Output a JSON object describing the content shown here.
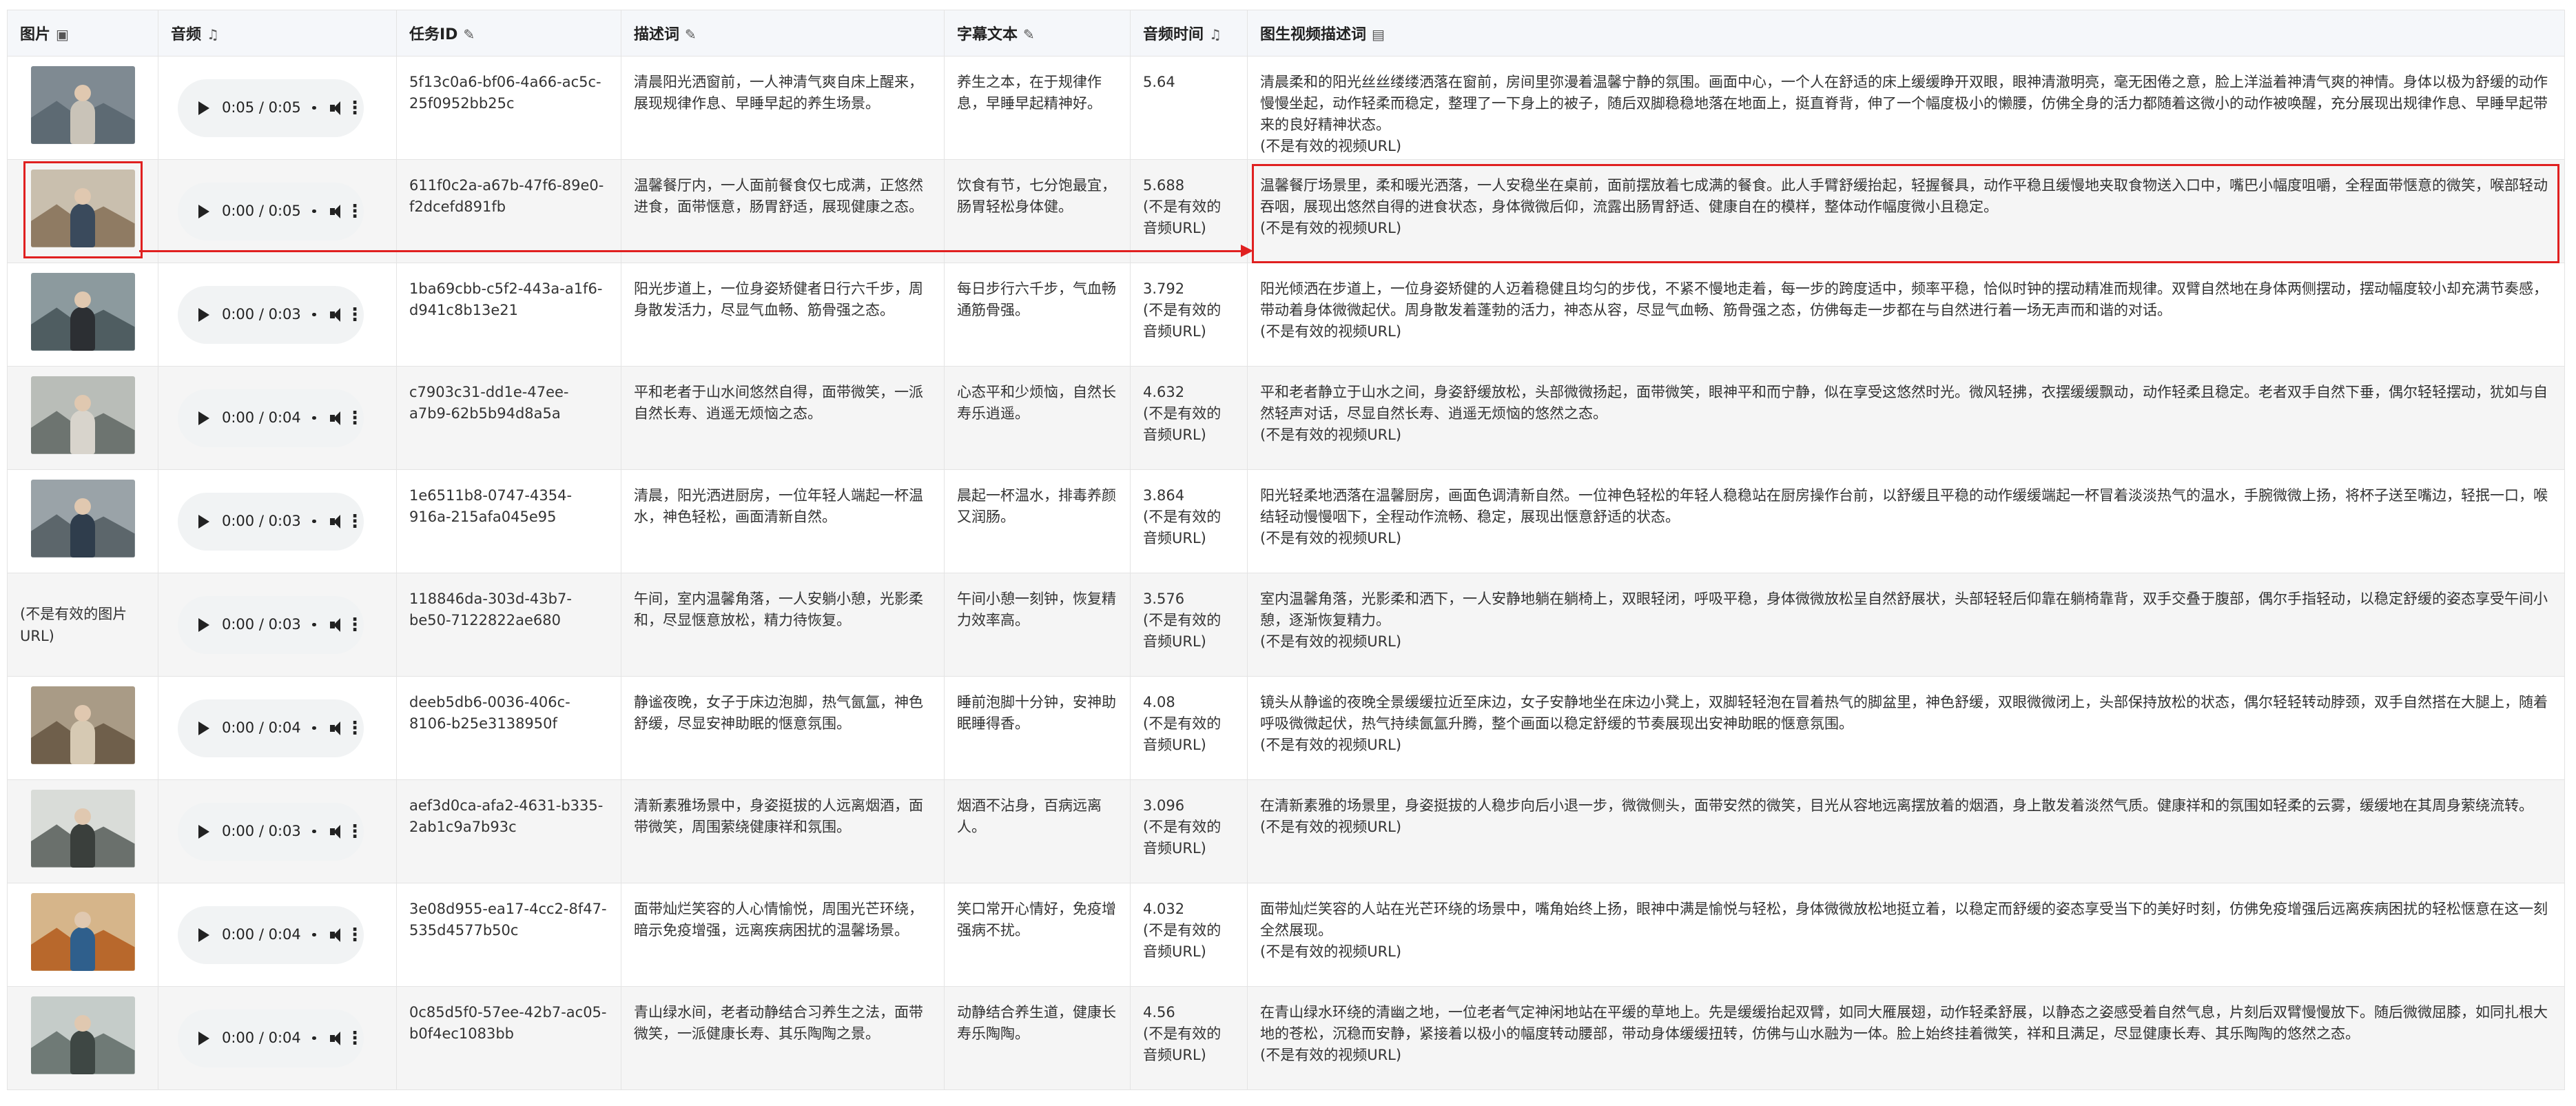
{
  "headers": {
    "image": "图片",
    "audio": "音频",
    "task_id": "任务ID",
    "description": "描述词",
    "subtitle": "字幕文本",
    "audio_time": "音频时间",
    "video_desc": "图生视频描述词"
  },
  "header_icons": {
    "image": "image-icon",
    "audio": "music-note-icon",
    "task_id": "memo-icon",
    "description": "memo-icon",
    "subtitle": "memo-icon",
    "audio_time": "music-note-icon",
    "video_desc": "notebook-icon"
  },
  "rows": [
    {
      "thumb": "bedroom",
      "audio_time_label": "0:05 / 0:05",
      "task_id": "5f13c0a6-bf06-4a66-ac5c-25f0952bb25c",
      "description": "清晨阳光洒窗前，一人神清气爽自床上醒来，展现规律作息、早睡早起的养生场景。",
      "subtitle": "养生之本，在于规律作息，早睡早起精神好。",
      "duration": "5.64",
      "duration_note": "",
      "video_desc": "清晨柔和的阳光丝丝缕缕洒落在窗前，房间里弥漫着温馨宁静的氛围。画面中心，一个人在舒适的床上缓缓睁开双眼，眼神清澈明亮，毫无困倦之意，脸上洋溢着神清气爽的神情。身体以极为舒缓的动作慢慢坐起，动作轻柔而稳定，整理了一下身上的被子，随后双脚稳稳地落在地面上，挺直脊背，伸了一个幅度极小的懒腰，仿佛全身的活力都随着这微小的动作被唤醒，充分展现出规律作息、早睡早起带来的良好精神状态。",
      "video_note": "(不是有效的视频URL)"
    },
    {
      "thumb": "dining",
      "audio_time_label": "0:00 / 0:05",
      "task_id": "611f0c2a-a67b-47f6-89e0-f2dcefd891fb",
      "description": "温馨餐厅内，一人面前餐食仅七成满，正悠然进食，面带惬意，肠胃舒适，展现健康之态。",
      "subtitle": "饮食有节，七分饱最宜，肠胃轻松身体健。",
      "duration": "5.688",
      "duration_note": "(不是有效的音频URL)",
      "video_desc": "温馨餐厅场景里，柔和暖光洒落，一人安稳坐在桌前，面前摆放着七成满的餐食。此人手臂舒缓抬起，轻握餐具，动作平稳且缓慢地夹取食物送入口中，嘴巴小幅度咀嚼，全程面带惬意的微笑，喉部轻动吞咽，展现出悠然自得的进食状态，身体微微后仰，流露出肠胃舒适、健康自在的模样，整体动作幅度微小且稳定。",
      "video_note": "(不是有效的视频URL)"
    },
    {
      "thumb": "walk",
      "audio_time_label": "0:00 / 0:03",
      "task_id": "1ba69cbb-c5f2-443a-a1f6-d941c8b13e21",
      "description": "阳光步道上，一位身姿矫健者日行六千步，周身散发活力，尽显气血畅、筋骨强之态。",
      "subtitle": "每日步行六千步，气血畅通筋骨强。",
      "duration": "3.792",
      "duration_note": "(不是有效的音频URL)",
      "video_desc": "阳光倾洒在步道上，一位身姿矫健的人迈着稳健且均匀的步伐，不紧不慢地走着，每一步的跨度适中，频率平稳，恰似时钟的摆动精准而规律。双臂自然地在身体两侧摆动，摆动幅度较小却充满节奏感，带动着身体微微起伏。周身散发着蓬勃的活力，神态从容，尽显气血畅、筋骨强之态，仿佛每走一步都在与自然进行着一场无声而和谐的对话。",
      "video_note": "(不是有效的视频URL)"
    },
    {
      "thumb": "elder",
      "audio_time_label": "0:00 / 0:04",
      "task_id": "c7903c31-dd1e-47ee-a7b9-62b5b94d8a5a",
      "description": "平和老者于山水间悠然自得，面带微笑，一派自然长寿、逍遥无烦恼之态。",
      "subtitle": "心态平和少烦恼，自然长寿乐逍遥。",
      "duration": "4.632",
      "duration_note": "(不是有效的音频URL)",
      "video_desc": "平和老者静立于山水之间，身姿舒缓放松，头部微微扬起，面带微笑，眼神平和而宁静，似在享受这悠然时光。微风轻拂，衣摆缓缓飘动，动作轻柔且稳定。老者双手自然下垂，偶尔轻轻摆动，犹如与自然轻声对话，尽显自然长寿、逍遥无烦恼的悠然之态。",
      "video_note": "(不是有效的视频URL)"
    },
    {
      "thumb": "kitchen",
      "audio_time_label": "0:00 / 0:03",
      "task_id": "1e6511b8-0747-4354-916a-215afa045e95",
      "description": "清晨，阳光洒进厨房，一位年轻人端起一杯温水，神色轻松，画面清新自然。",
      "subtitle": "晨起一杯温水，排毒养颜又润肠。",
      "duration": "3.864",
      "duration_note": "(不是有效的音频URL)",
      "video_desc": "阳光轻柔地洒落在温馨厨房，画面色调清新自然。一位神色轻松的年轻人稳稳站在厨房操作台前，以舒缓且平稳的动作缓缓端起一杯冒着淡淡热气的温水，手腕微微上扬，将杯子送至嘴边，轻抿一口，喉结轻动慢慢咽下，全程动作流畅、稳定，展现出惬意舒适的状态。",
      "video_note": "(不是有效的视频URL)"
    },
    {
      "thumb": "",
      "image_note": "(不是有效的图片URL)",
      "audio_time_label": "0:00 / 0:03",
      "task_id": "118846da-303d-43b7-be50-7122822ae680",
      "description": "午间，室内温馨角落，一人安躺小憩，光影柔和，尽显惬意放松，精力待恢复。",
      "subtitle": "午间小憩一刻钟，恢复精力效率高。",
      "duration": "3.576",
      "duration_note": "(不是有效的音频URL)",
      "video_desc": "室内温馨角落，光影柔和洒下，一人安静地躺在躺椅上，双眼轻闭，呼吸平稳，身体微微放松呈自然舒展状，头部轻轻后仰靠在躺椅靠背，双手交叠于腹部，偶尔手指轻动，以稳定舒缓的姿态享受午间小憩，逐渐恢复精力。",
      "video_note": "(不是有效的视频URL)"
    },
    {
      "thumb": "footbath",
      "audio_time_label": "0:00 / 0:04",
      "task_id": "deeb5db6-0036-406c-8106-b25e3138950f",
      "description": "静谧夜晚，女子于床边泡脚，热气氤氲，神色舒缓，尽显安神助眠的惬意氛围。",
      "subtitle": "睡前泡脚十分钟，安神助眠睡得香。",
      "duration": "4.08",
      "duration_note": "(不是有效的音频URL)",
      "video_desc": "镜头从静谧的夜晚全景缓缓拉近至床边，女子安静地坐在床边小凳上，双脚轻轻泡在冒着热气的脚盆里，神色舒缓，双眼微微闭上，头部保持放松的状态，偶尔轻轻转动脖颈，双手自然搭在大腿上，随着呼吸微微起伏，热气持续氤氲升腾，整个画面以稳定舒缓的节奏展现出安神助眠的惬意氛围。",
      "video_note": "(不是有效的视频URL)"
    },
    {
      "thumb": "ink",
      "audio_time_label": "0:00 / 0:03",
      "task_id": "aef3d0ca-afa2-4631-b335-2ab1c9a7b93c",
      "description": "清新素雅场景中，身姿挺拔的人远离烟酒，面带微笑，周围萦绕健康祥和氛围。",
      "subtitle": "烟酒不沾身，百病远离人。",
      "duration": "3.096",
      "duration_note": "(不是有效的音频URL)",
      "video_desc": "在清新素雅的场景里，身姿挺拔的人稳步向后小退一步，微微侧头，面带安然的微笑，目光从容地远离摆放着的烟酒，身上散发着淡然气质。健康祥和的氛围如轻柔的云雾，缓缓地在其周身萦绕流转。",
      "video_note": "(不是有效的视频URL)"
    },
    {
      "thumb": "flowers",
      "audio_time_label": "0:00 / 0:04",
      "task_id": "3e08d955-ea17-4cc2-8f47-535d4577b50c",
      "description": "面带灿烂笑容的人心情愉悦，周围光芒环绕，暗示免疫增强，远离疾病困扰的温馨场景。",
      "subtitle": "笑口常开心情好，免疫增强病不扰。",
      "duration": "4.032",
      "duration_note": "(不是有效的音频URL)",
      "video_desc": "面带灿烂笑容的人站在光芒环绕的场景中，嘴角始终上扬，眼神中满是愉悦与轻松，身体微微放松地挺立着，以稳定而舒缓的姿态享受当下的美好时刻，仿佛免疫增强后远离疾病困扰的轻松惬意在这一刻全然展现。",
      "video_note": "(不是有效的视频URL)"
    },
    {
      "thumb": "mountain",
      "audio_time_label": "0:00 / 0:04",
      "task_id": "0c85d5f0-57ee-42b7-ac05-b0f4ec1083bb",
      "description": "青山绿水间，老者动静结合习养生之法，面带微笑，一派健康长寿、其乐陶陶之景。",
      "subtitle": "动静结合养生道，健康长寿乐陶陶。",
      "duration": "4.56",
      "duration_note": "(不是有效的音频URL)",
      "video_desc": "在青山绿水环绕的清幽之地，一位老者气定神闲地站在平缓的草地上。先是缓缓抬起双臂，如同大雁展翅，动作轻柔舒展，以静态之姿感受着自然气息，片刻后双臂慢慢放下。随后微微屈膝，如同扎根大地的苍松，沉稳而安静，紧接着以极小的幅度转动腰部，带动身体缓缓扭转，仿佛与山水融为一体。脸上始终挂着微笑，祥和且满足，尽显健康长寿、其乐陶陶的悠然之态。",
      "video_note": "(不是有效的视频URL)"
    }
  ],
  "colors": {
    "highlight": "#e02020",
    "header_bg": "#f5f7fa",
    "row_alt_bg": "#f5f5f5",
    "player_bg": "#f1f3f4"
  }
}
